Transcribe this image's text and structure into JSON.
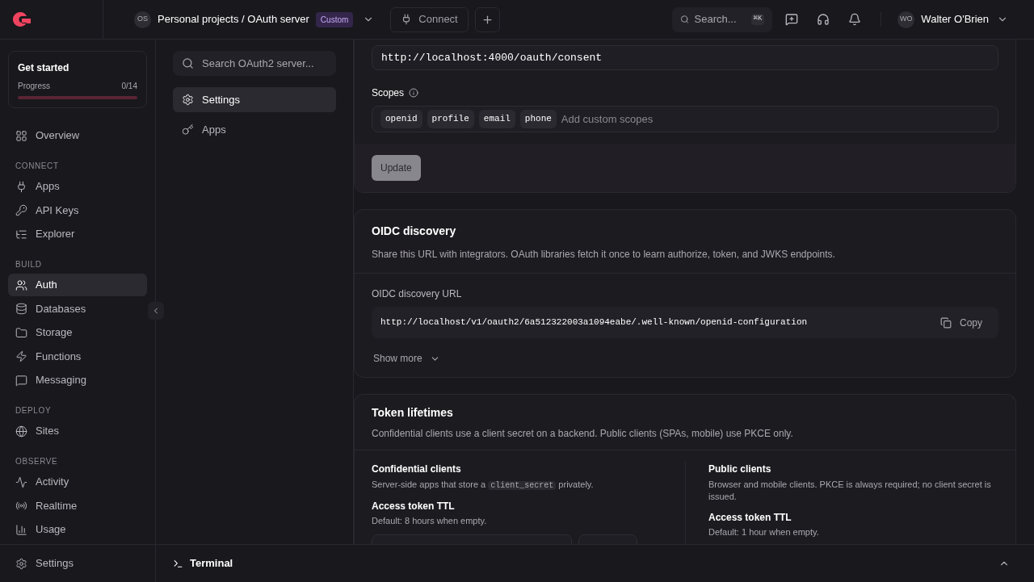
{
  "header": {
    "org_initials": "OS",
    "breadcrumb": "Personal projects / OAuth server",
    "plan_badge": "Custom",
    "connect": "Connect",
    "search": {
      "placeholder": "Search...",
      "shortcut": "⌘K"
    },
    "user": {
      "initials": "WO",
      "name": "Walter O'Brien"
    }
  },
  "sidebar": {
    "get_started": {
      "title": "Get started",
      "progress_label": "Progress",
      "progress_text": "0/14",
      "level": 0
    },
    "top_item": {
      "label": "Overview",
      "selected": false
    },
    "sections": [
      {
        "title": "CONNECT",
        "items": [
          {
            "label": "Apps",
            "selected": false
          },
          {
            "label": "API Keys",
            "selected": false
          },
          {
            "label": "Explorer",
            "selected": false
          }
        ]
      },
      {
        "title": "BUILD",
        "items": [
          {
            "label": "Auth",
            "selected": true
          },
          {
            "label": "Databases",
            "selected": false
          },
          {
            "label": "Storage",
            "selected": false
          },
          {
            "label": "Functions",
            "selected": false
          },
          {
            "label": "Messaging",
            "selected": false
          }
        ]
      },
      {
        "title": "DEPLOY",
        "items": [
          {
            "label": "Sites",
            "selected": false
          }
        ]
      },
      {
        "title": "OBSERVE",
        "items": [
          {
            "label": "Activity",
            "selected": false
          },
          {
            "label": "Realtime",
            "selected": false
          },
          {
            "label": "Usage",
            "selected": false
          }
        ]
      }
    ],
    "bottom_item": "Settings"
  },
  "subnav": {
    "search": {
      "placeholder": "Search OAuth2 server..."
    },
    "items": [
      {
        "label": "Settings",
        "selected": true
      },
      {
        "label": "Apps",
        "selected": false
      }
    ]
  },
  "consent_card": {
    "url_value": "http://localhost:4000/oauth/consent",
    "scopes_label": "Scopes",
    "scopes": [
      "openid",
      "profile",
      "email",
      "phone"
    ],
    "scopes_placeholder": "Add custom scopes",
    "update_button": {
      "label": "Update",
      "disabled": true
    }
  },
  "oidc_card": {
    "title": "OIDC discovery",
    "description": "Share this URL with integrators. OAuth libraries fetch it once to learn authorize, token, and JWKS endpoints.",
    "url_label": "OIDC discovery URL",
    "url": "http://localhost/v1/oauth2/6a512322003a1094eabe/.well-known/openid-configuration",
    "copy": "Copy",
    "show_more": "Show more"
  },
  "token_card": {
    "title": "Token lifetimes",
    "description": "Confidential clients use a client secret on a backend. Public clients (SPAs, mobile) use PKCE only.",
    "columns": [
      {
        "title": "Confidential clients",
        "description": {
          "before": "Server-side apps that store a ",
          "code": "client_secret",
          "after": " privately."
        },
        "field_label": "Access token TTL",
        "field_hint": "Default: 8 hours when empty.",
        "has_fields": true
      },
      {
        "title": "Public clients",
        "description": {
          "before": "Browser and mobile clients. PKCE is always required; no client secret is issued."
        },
        "field_label": "Access token TTL",
        "field_hint": "Default: 1 hour when empty.",
        "has_fields": false
      }
    ]
  },
  "terminal": {
    "label": "Terminal"
  }
}
